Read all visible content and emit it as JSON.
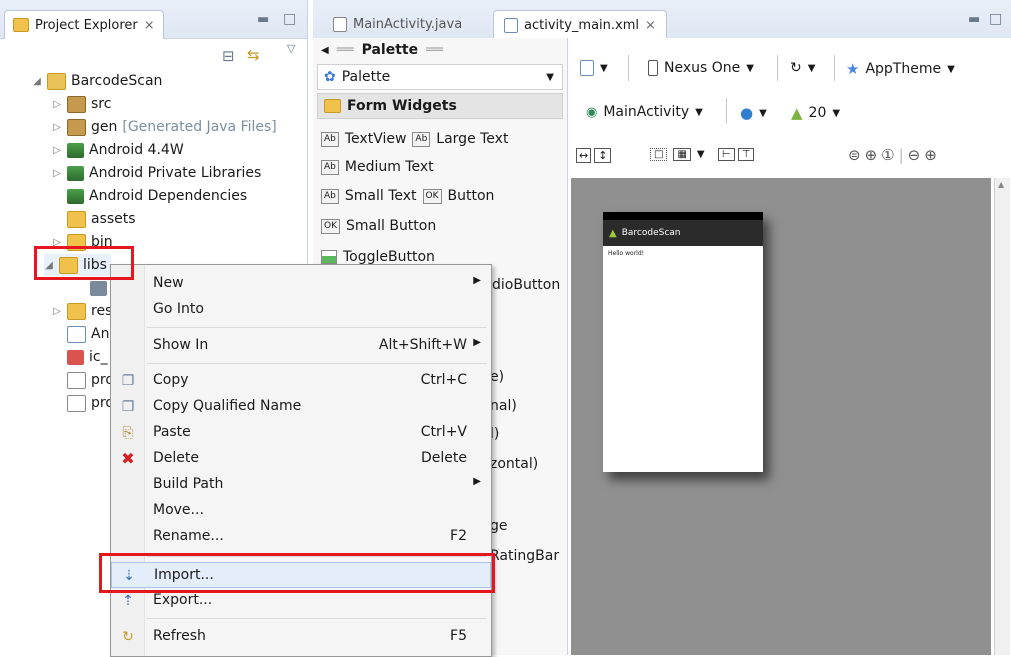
{
  "project_explorer": {
    "tab_label": "Project Explorer",
    "close_glyph": "⨯",
    "tree": [
      {
        "label": "BarcodeScan",
        "note": "",
        "icon": "project-icon"
      },
      {
        "label": "src",
        "note": "",
        "icon": "package-folder-icon"
      },
      {
        "label": "gen",
        "note": "[Generated Java Files]",
        "icon": "package-folder-icon"
      },
      {
        "label": "Android 4.4W",
        "note": "",
        "icon": "library-icon"
      },
      {
        "label": "Android Private Libraries",
        "note": "",
        "icon": "library-icon"
      },
      {
        "label": "Android Dependencies",
        "note": "",
        "icon": "library-icon"
      },
      {
        "label": "assets",
        "note": "",
        "icon": "folder-icon"
      },
      {
        "label": "bin",
        "note": "",
        "icon": "folder-icon"
      },
      {
        "label": "libs",
        "note": "",
        "icon": "folder-icon"
      },
      {
        "label": "",
        "note": "",
        "icon": "jar-icon"
      },
      {
        "label": "res",
        "note": "",
        "icon": "folder-icon"
      },
      {
        "label": "An",
        "note": "",
        "icon": "xml-file-icon"
      },
      {
        "label": "ic_",
        "note": "",
        "icon": "image-file-icon"
      },
      {
        "label": "pro",
        "note": "",
        "icon": "file-icon"
      },
      {
        "label": "pro",
        "note": "",
        "icon": "file-icon"
      }
    ]
  },
  "editor": {
    "tabs": [
      {
        "label": "MainActivity.java",
        "active": false
      },
      {
        "label": "activity_main.xml",
        "active": true
      }
    ],
    "close_glyph": "⨯"
  },
  "palette": {
    "header": "Palette",
    "dropdown": "Palette",
    "section": "Form Widgets",
    "widgets": [
      {
        "row": 0,
        "items": [
          {
            "badge": "Ab",
            "label": "TextView"
          },
          {
            "badge": "Ab",
            "label": "Large Text"
          }
        ]
      },
      {
        "row": 1,
        "items": [
          {
            "badge": "Ab",
            "label": "Medium Text"
          }
        ]
      },
      {
        "row": 2,
        "items": [
          {
            "badge": "Ab",
            "label": "Small Text"
          },
          {
            "badge": "OK",
            "label": "Button"
          }
        ]
      },
      {
        "row": 3,
        "items": [
          {
            "badge": "OK",
            "label": "Small Button"
          }
        ]
      },
      {
        "row": 4,
        "items": [
          {
            "badge": "",
            "label": "ToggleButton"
          }
        ]
      }
    ],
    "partial_visible": [
      "dioButton",
      "e)",
      "nal)",
      "l)",
      "zontal)",
      "ge",
      "RatingBar"
    ]
  },
  "layout_toolbar": {
    "device": "Nexus One",
    "theme": "AppTheme",
    "activity": "MainActivity",
    "api_level": "20"
  },
  "preview": {
    "app_title": "BarcodeScan",
    "body_text": "Hello world!"
  },
  "context_menu": {
    "items": [
      {
        "label": "New",
        "shortcut": "",
        "submenu": true,
        "icon": ""
      },
      {
        "label": "Go Into",
        "shortcut": "",
        "submenu": false,
        "icon": ""
      },
      {
        "label": "Show In",
        "shortcut": "Alt+Shift+W",
        "submenu": true,
        "icon": ""
      },
      {
        "label": "Copy",
        "shortcut": "Ctrl+C",
        "submenu": false,
        "icon": "copy-icon"
      },
      {
        "label": "Copy Qualified Name",
        "shortcut": "",
        "submenu": false,
        "icon": "copy-qualified-icon"
      },
      {
        "label": "Paste",
        "shortcut": "Ctrl+V",
        "submenu": false,
        "icon": "paste-icon"
      },
      {
        "label": "Delete",
        "shortcut": "Delete",
        "submenu": false,
        "icon": "delete-icon"
      },
      {
        "label": "Build Path",
        "shortcut": "",
        "submenu": true,
        "icon": ""
      },
      {
        "label": "Move...",
        "shortcut": "",
        "submenu": false,
        "icon": ""
      },
      {
        "label": "Rename...",
        "shortcut": "F2",
        "submenu": false,
        "icon": ""
      },
      {
        "label": "Import...",
        "shortcut": "",
        "submenu": false,
        "icon": "import-icon"
      },
      {
        "label": "Export...",
        "shortcut": "",
        "submenu": false,
        "icon": "export-icon"
      },
      {
        "label": "Refresh",
        "shortcut": "F5",
        "submenu": false,
        "icon": "refresh-icon"
      }
    ]
  },
  "colors": {
    "highlight_red": "#e5161f",
    "selection_blue": "#e4eefb"
  }
}
